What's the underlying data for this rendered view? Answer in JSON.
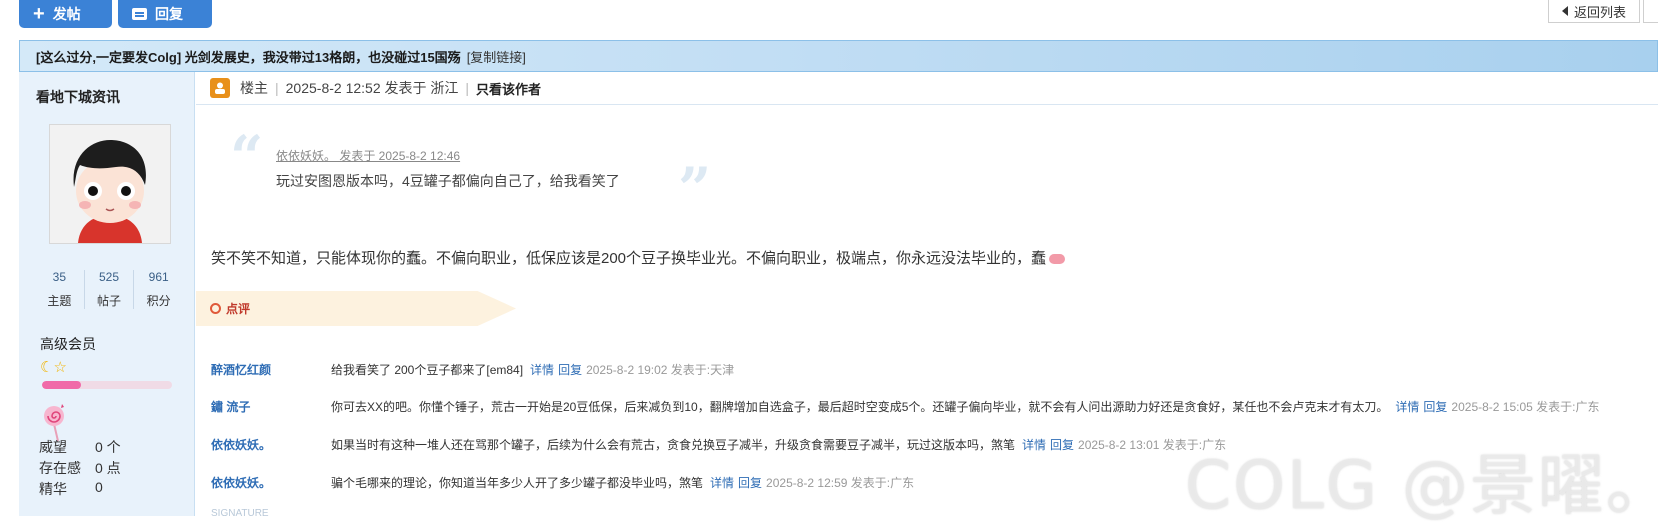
{
  "toolbar": {
    "post_label": "发帖",
    "reply_label": "回复",
    "back_label": "返回列表"
  },
  "thread": {
    "title": "[这么过分,一定要发Colg] 光剑发展史，我没带过13格朗，也没碰过15国殇",
    "copy_link": "[复制链接]"
  },
  "author": {
    "name": "看地下城资讯",
    "stats": [
      {
        "value": "35",
        "label": "主题"
      },
      {
        "value": "525",
        "label": "帖子"
      },
      {
        "value": "961",
        "label": "积分"
      }
    ],
    "level": "高级会员",
    "level_icons": "☾☆",
    "level_progress": 0.3,
    "credits": [
      {
        "key": "威望",
        "value": "0 个"
      },
      {
        "key": "存在感",
        "value": "0 点"
      },
      {
        "key": "精华",
        "value": "0"
      }
    ]
  },
  "post": {
    "floor": "楼主",
    "time": "2025-8-2 12:52 发表于 浙江",
    "only_author": "只看该作者",
    "quote_meta": "依依妖妖。 发表于 2025-8-2 12:46",
    "quote_text": "玩过安图恩版本吗，4豆罐子都偏向自己了，给我看笑了",
    "body": "笑不笑不知道，只能体现你的蠢。不偏向职业，低保应该是200个豆子换毕业光。不偏向职业，极端点，你永远没法毕业的，蠢"
  },
  "review": {
    "label": "点评",
    "comments": [
      {
        "user": "醉酒忆红颜",
        "text": "给我看笑了 200个豆子都来了[em84]",
        "detail": "详情",
        "reply": "回复",
        "time": "2025-8-2 19:02 发表于:天津"
      },
      {
        "user": "鏽 流子",
        "text": "你可去XX的吧。你懂个锤子，荒古一开始是20豆低保，后来减负到10，翻牌增加自选盒子，最后超时空变成5个。还罐子偏向毕业，就不会有人问出源助力好还是贪食好，某任也不会卢克末才有太刀。",
        "detail": "详情",
        "reply": "回复",
        "time": "2025-8-2 15:05 发表于:广东"
      },
      {
        "user": "依依妖妖。",
        "text": "如果当时有这种一堆人还在骂那个罐子，后续为什么会有荒古，贪食兑换豆子减半，升级贪食需要豆子减半，玩过这版本吗，煞笔",
        "detail": "详情",
        "reply": "回复",
        "time": "2025-8-2 13:01 发表于:广东"
      },
      {
        "user": "依依妖妖。",
        "text": "骗个毛哪来的理论，你知道当年多少人开了多少罐子都没毕业吗，煞笔",
        "detail": "详情",
        "reply": "回复",
        "time": "2025-8-2 12:59 发表于:广东"
      }
    ]
  },
  "watermark": "COLG @景曜。",
  "signature_hint": "SIGNATURE"
}
